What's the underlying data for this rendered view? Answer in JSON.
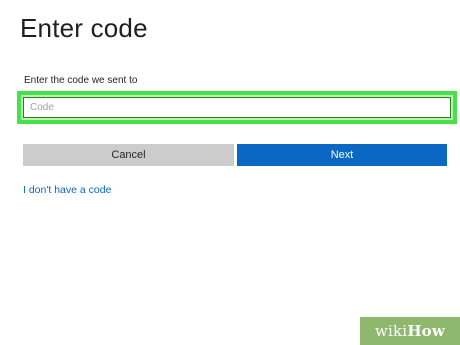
{
  "title": "Enter code",
  "form": {
    "label": "Enter the code we sent to",
    "code_placeholder": "Code",
    "code_value": ""
  },
  "buttons": {
    "cancel": "Cancel",
    "next": "Next"
  },
  "links": {
    "no_code": "I don't have a code"
  },
  "watermark": {
    "part1": "wiki",
    "part2": "How"
  },
  "colors": {
    "primary": "#0b67c4",
    "secondary_button": "#cccccc",
    "highlight": "#48e14a"
  }
}
